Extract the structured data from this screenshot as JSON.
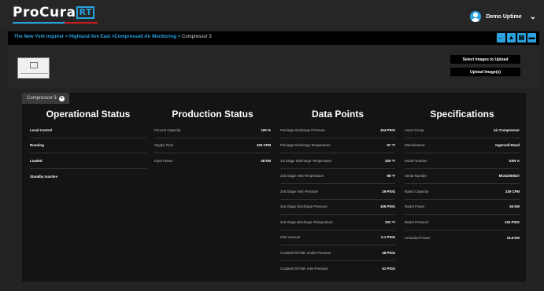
{
  "app": {
    "logo_text": "ProCura",
    "logo_badge": "RT"
  },
  "user": {
    "name": "Demo Uptime",
    "menu_icon": "chevron-down-icon"
  },
  "breadcrumb": {
    "path": "The New York Inquirer > Highland Ave East >Compressed Air Monitoring > ",
    "current": "Compressor 3"
  },
  "toolbar": {
    "icons": [
      "back-arrow-icon",
      "alert-triangle-icon",
      "chart-icon",
      "folder-icon"
    ],
    "glyphs": [
      "←",
      "▲",
      "▤",
      "▬"
    ]
  },
  "images": {
    "select_label": "Select Images to Upload",
    "upload_label": "Upload Image(s)"
  },
  "tab": {
    "label": "Compressor 3",
    "close_glyph": "×"
  },
  "operational": {
    "title": "Operational Status",
    "rows": [
      "Local Control",
      "Running",
      "Loaded",
      "Standby Inactive"
    ]
  },
  "production": {
    "title": "Production Status",
    "rows": [
      {
        "label": "Percent Capacity",
        "value": "100 %"
      },
      {
        "label": "Supply Flow",
        "value": "229 CFM"
      },
      {
        "label": "Input Power",
        "value": "48 kW"
      }
    ]
  },
  "datapoints": {
    "title": "Data Points",
    "rows": [
      {
        "label": "Package Discharge Pressure",
        "value": "104 PSIG"
      },
      {
        "label": "Package Discharge Temperature",
        "value": "97 °F"
      },
      {
        "label": "1st Stage Discharge Temperature",
        "value": "320 °F"
      },
      {
        "label": "2nd Stage Inlet Temperature",
        "value": "98 °F"
      },
      {
        "label": "2nd Stage Inlet Pressure",
        "value": "29 PSIG"
      },
      {
        "label": "2nd Stage Discharge Pressure",
        "value": "105 PSIG"
      },
      {
        "label": "2nd Stage Discharge Temperature",
        "value": "331 °F"
      },
      {
        "label": "Inlet Vacuum",
        "value": "0.1 PSIG"
      },
      {
        "label": "Coolant/Oil Filter Outlet Pressure",
        "value": "48 PSIG"
      },
      {
        "label": "Coolant/Oil Filter Inlet Pressure",
        "value": "51 PSIG"
      }
    ]
  },
  "specifications": {
    "title": "Specifications",
    "rows": [
      {
        "label": "Asset Group",
        "value": "Air Compressor"
      },
      {
        "label": "Manufacturer",
        "value": "Ingersoll-Rand"
      },
      {
        "label": "Model Number",
        "value": "SSR-A"
      },
      {
        "label": "Serial Number",
        "value": "MC81000537"
      },
      {
        "label": "Rated Capacity",
        "value": "229 CFM"
      },
      {
        "label": "Rated Power",
        "value": "55 kW"
      },
      {
        "label": "Rated Pressure",
        "value": "125 PSIG"
      },
      {
        "label": "Unloaded Power",
        "value": "16.6 kW"
      }
    ]
  }
}
